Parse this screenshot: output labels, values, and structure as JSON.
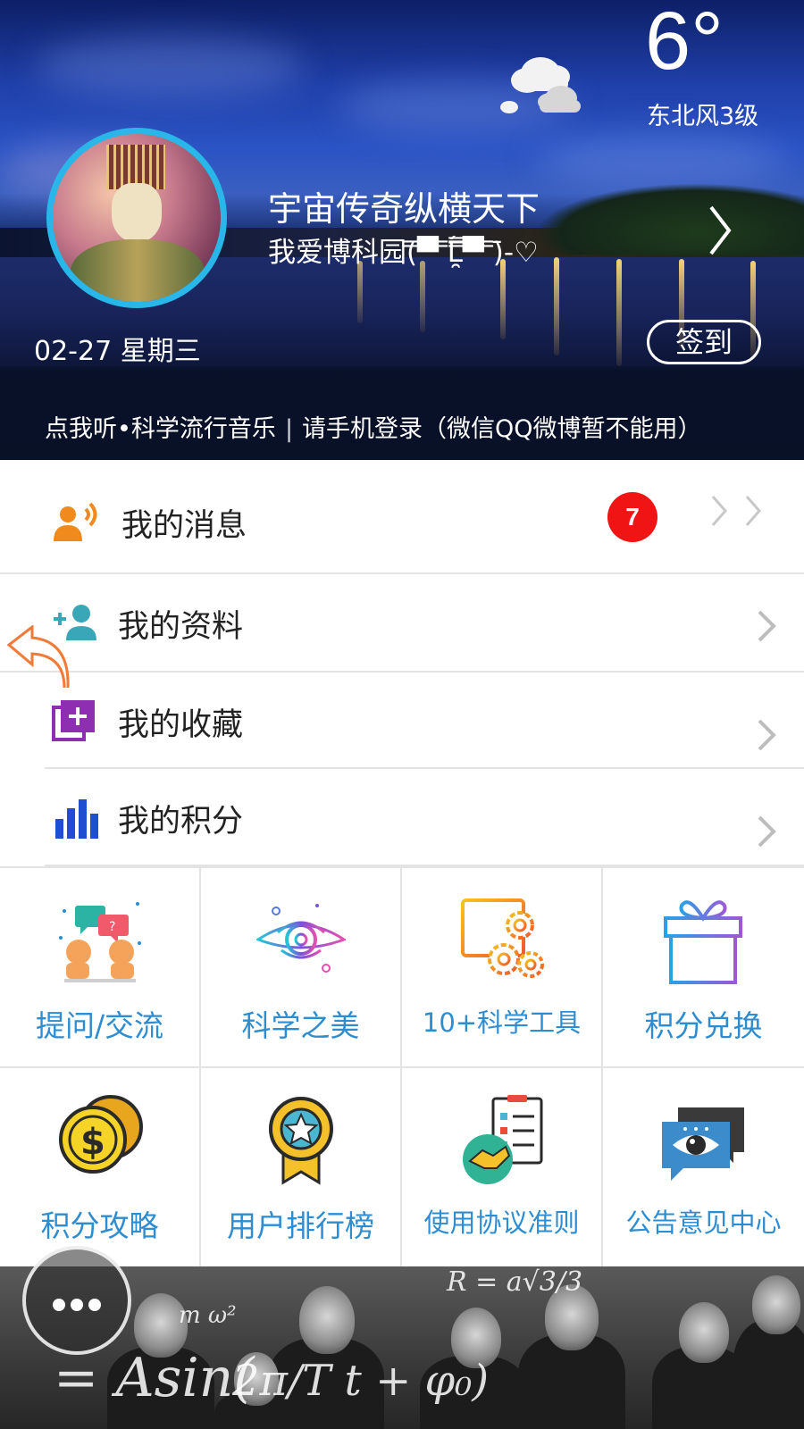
{
  "header": {
    "temperature": "6°",
    "wind": "东北风3级",
    "weather_icon": "cloudy-icon",
    "username": "宇宙传奇纵横天下",
    "motto": "我爱博科园(̿▀̿ ̿Ĺ̯̿̿▀̿ ̿)̄-♡",
    "date": "02-27 星期三",
    "signin_label": "签到",
    "link_music": "点我听•科学流行音乐",
    "link_separator": "|",
    "link_login": "请手机登录（微信QQ微博暂不能用）"
  },
  "menu": {
    "messages": {
      "label": "我的消息",
      "badge": "7",
      "icon": "speaker-person-icon"
    },
    "profile": {
      "label": "我的资料",
      "icon": "add-user-icon"
    },
    "favorites": {
      "label": "我的收藏",
      "icon": "add-collection-icon"
    },
    "points": {
      "label": "我的积分",
      "icon": "bar-chart-icon"
    }
  },
  "grid": [
    {
      "label": "提问/交流",
      "icon": "discussion-icon"
    },
    {
      "label": "科学之美",
      "icon": "black-hole-icon"
    },
    {
      "label": "10+科学工具",
      "icon": "settings-tools-icon"
    },
    {
      "label": "积分兑换",
      "icon": "gift-icon"
    },
    {
      "label": "积分攻略",
      "icon": "coins-icon"
    },
    {
      "label": "用户排行榜",
      "icon": "medal-icon"
    },
    {
      "label": "使用协议准则",
      "icon": "agreement-icon"
    },
    {
      "label": "公告意见中心",
      "icon": "eye-chat-icon"
    }
  ],
  "colors": {
    "accent_blue": "#2e8cd0",
    "badge_red": "#f01414",
    "avatar_ring": "#29b6e8"
  }
}
